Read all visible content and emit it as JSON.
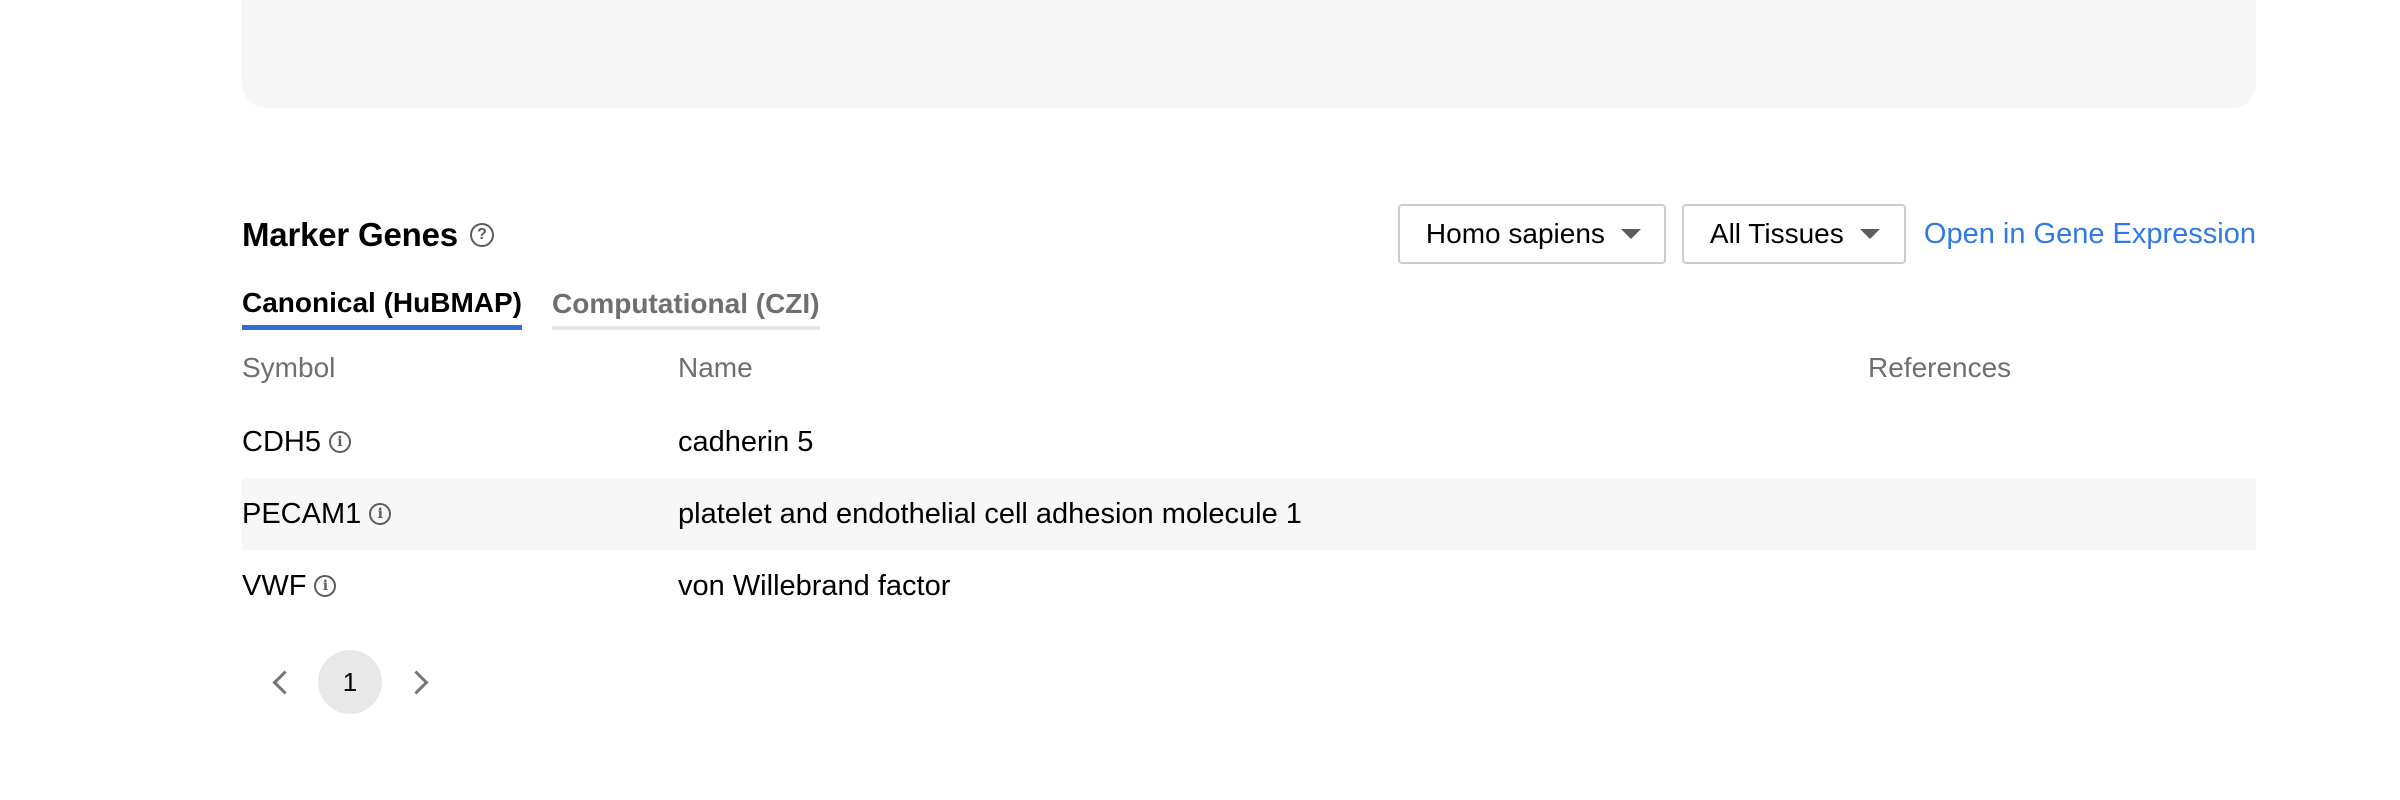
{
  "section": {
    "title": "Marker Genes",
    "help_icon": "question-circle-icon"
  },
  "controls": {
    "species": "Homo sapiens",
    "tissues": "All Tissues",
    "open_link": "Open in Gene Expression",
    "link_color": "#2f7ae5"
  },
  "tabs": [
    {
      "label": "Canonical (HuBMAP)",
      "active": true
    },
    {
      "label": "Computational (CZI)",
      "active": false
    }
  ],
  "table": {
    "headers": {
      "symbol": "Symbol",
      "name": "Name",
      "references": "References"
    },
    "rows": [
      {
        "symbol": "CDH5",
        "name": "cadherin 5",
        "references": ""
      },
      {
        "symbol": "PECAM1",
        "name": "platelet and endothelial cell adhesion molecule 1",
        "references": ""
      },
      {
        "symbol": "VWF",
        "name": "von Willebrand factor",
        "references": ""
      }
    ]
  },
  "pagination": {
    "current_page": "1",
    "prev_icon": "chevron-left-icon",
    "next_icon": "chevron-right-icon"
  }
}
